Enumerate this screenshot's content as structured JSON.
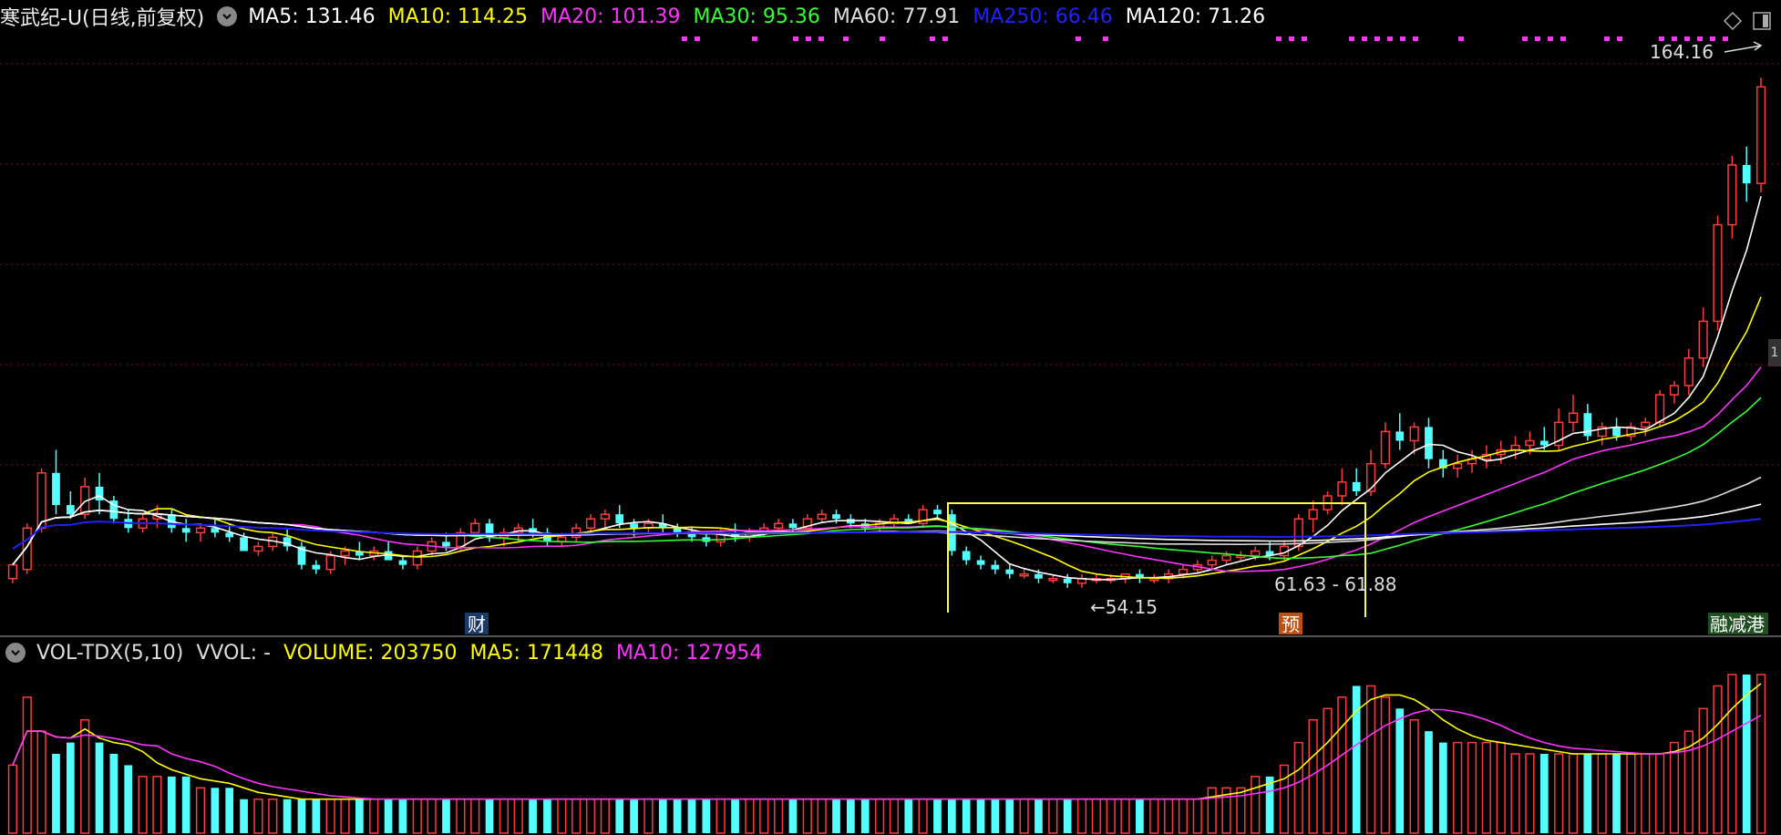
{
  "main": {
    "stock_name": "寒武纪-U(日线,前复权)",
    "ma": [
      {
        "label": "MA5:",
        "value": "131.46",
        "color": "#ffffff"
      },
      {
        "label": "MA10:",
        "value": "114.25",
        "color": "#ffff00"
      },
      {
        "label": "MA20:",
        "value": "101.39",
        "color": "#ff33ff"
      },
      {
        "label": "MA30:",
        "value": "95.36",
        "color": "#33ff33"
      },
      {
        "label": "MA60:",
        "value": "77.91",
        "color": "#dddddd"
      },
      {
        "label": "MA250:",
        "value": "66.46",
        "color": "#2020ff"
      },
      {
        "label": "MA120:",
        "value": "71.26",
        "color": "#ffffff"
      }
    ],
    "high_label": "164.16",
    "low_label": "54.15",
    "range_label": "61.63 - 61.88",
    "marker_cai": "财",
    "marker_yu": "预",
    "marker_right": "融减港",
    "side_tab": "1"
  },
  "volume": {
    "indicator": "VOL-TDX(5,10)",
    "vvol": "VVOL: -",
    "volume": "VOLUME: 203750",
    "ma5": "MA5: 171448",
    "ma10": "MA10: 127954"
  },
  "colors": {
    "up": "#ff3b3b",
    "down": "#54ffff",
    "ma5": "#ffffff",
    "ma10": "#ffff00",
    "ma20": "#ff33ff",
    "ma30": "#33ff33",
    "ma60": "#dddddd",
    "ma120": "#ffffff",
    "ma250": "#2020ff",
    "grid": "#7a1010",
    "box": "#ffff44"
  },
  "chart_data": {
    "type": "candlestick",
    "candles": [
      [
        56,
        59,
        55,
        59
      ],
      [
        58,
        68,
        57,
        67
      ],
      [
        67,
        80,
        66,
        79
      ],
      [
        79,
        84,
        70,
        72
      ],
      [
        72,
        75,
        69,
        70
      ],
      [
        70,
        78,
        69,
        76
      ],
      [
        76,
        79,
        70,
        73
      ],
      [
        73,
        74,
        68,
        69
      ],
      [
        69,
        71,
        66,
        67
      ],
      [
        67,
        70,
        66,
        69
      ],
      [
        69,
        72,
        67,
        70
      ],
      [
        70,
        71,
        66,
        67
      ],
      [
        67,
        69,
        64,
        66
      ],
      [
        66,
        68,
        64,
        67
      ],
      [
        67,
        69,
        65,
        66
      ],
      [
        66,
        68,
        64,
        65
      ],
      [
        65,
        66,
        62,
        62
      ],
      [
        62,
        64,
        61,
        63
      ],
      [
        63,
        66,
        62,
        65
      ],
      [
        65,
        67,
        62,
        63
      ],
      [
        63,
        64,
        58,
        59
      ],
      [
        59,
        60,
        57,
        58
      ],
      [
        58,
        62,
        57,
        61
      ],
      [
        61,
        63,
        59,
        62
      ],
      [
        62,
        64,
        60,
        61
      ],
      [
        61,
        63,
        60,
        62
      ],
      [
        62,
        64,
        60,
        60
      ],
      [
        60,
        61,
        58,
        59
      ],
      [
        59,
        63,
        58,
        62
      ],
      [
        62,
        65,
        61,
        64
      ],
      [
        64,
        66,
        62,
        63
      ],
      [
        63,
        67,
        62,
        66
      ],
      [
        66,
        69,
        65,
        68
      ],
      [
        68,
        69,
        64,
        65
      ],
      [
        65,
        67,
        63,
        66
      ],
      [
        66,
        68,
        64,
        67
      ],
      [
        67,
        69,
        65,
        66
      ],
      [
        66,
        67,
        63,
        64
      ],
      [
        64,
        66,
        63,
        65
      ],
      [
        65,
        68,
        64,
        67
      ],
      [
        67,
        70,
        66,
        69
      ],
      [
        69,
        71,
        67,
        70
      ],
      [
        70,
        72,
        67,
        68
      ],
      [
        68,
        69,
        65,
        67
      ],
      [
        67,
        69,
        66,
        68
      ],
      [
        68,
        70,
        66,
        67
      ],
      [
        67,
        68,
        65,
        66
      ],
      [
        66,
        67,
        64,
        65
      ],
      [
        65,
        66,
        63,
        64
      ],
      [
        64,
        67,
        63,
        66
      ],
      [
        66,
        68,
        64,
        65
      ],
      [
        65,
        67,
        64,
        66
      ],
      [
        66,
        68,
        65,
        67
      ],
      [
        67,
        69,
        66,
        68
      ],
      [
        68,
        69,
        66,
        67
      ],
      [
        67,
        70,
        66,
        69
      ],
      [
        69,
        71,
        68,
        70
      ],
      [
        70,
        71,
        68,
        69
      ],
      [
        69,
        70,
        67,
        68
      ],
      [
        68,
        69,
        66,
        67
      ],
      [
        67,
        69,
        66,
        68
      ],
      [
        68,
        70,
        67,
        69
      ],
      [
        69,
        70,
        68,
        68
      ],
      [
        68,
        72,
        67,
        71
      ],
      [
        71,
        72,
        69,
        70
      ],
      [
        70,
        71,
        61,
        62
      ],
      [
        62,
        63,
        59,
        60
      ],
      [
        60,
        61,
        58,
        59
      ],
      [
        59,
        60,
        57,
        58
      ],
      [
        58,
        59,
        56,
        57
      ],
      [
        57,
        58,
        56,
        57
      ],
      [
        57,
        58,
        55,
        56
      ],
      [
        56,
        57,
        55,
        56
      ],
      [
        56,
        57,
        54,
        55
      ],
      [
        55,
        57,
        54,
        56
      ],
      [
        56,
        57,
        55,
        56
      ],
      [
        56,
        57,
        55,
        56
      ],
      [
        56,
        57,
        55,
        57
      ],
      [
        57,
        58,
        55,
        56
      ],
      [
        56,
        57,
        55,
        56
      ],
      [
        56,
        58,
        55,
        57
      ],
      [
        57,
        59,
        56,
        58
      ],
      [
        58,
        60,
        57,
        59
      ],
      [
        59,
        61,
        58,
        60
      ],
      [
        60,
        62,
        59,
        61
      ],
      [
        61,
        62,
        60,
        61
      ],
      [
        61,
        63,
        60,
        62
      ],
      [
        62,
        64,
        60,
        61
      ],
      [
        61,
        64,
        60,
        63
      ],
      [
        63,
        70,
        62,
        69
      ],
      [
        69,
        73,
        66,
        71
      ],
      [
        71,
        75,
        70,
        74
      ],
      [
        74,
        80,
        72,
        77
      ],
      [
        77,
        80,
        74,
        75
      ],
      [
        75,
        84,
        74,
        81
      ],
      [
        81,
        90,
        80,
        88
      ],
      [
        88,
        92,
        84,
        86
      ],
      [
        86,
        90,
        83,
        89
      ],
      [
        89,
        91,
        80,
        82
      ],
      [
        82,
        84,
        78,
        80
      ],
      [
        80,
        83,
        78,
        81
      ],
      [
        81,
        84,
        79,
        82
      ],
      [
        82,
        85,
        80,
        83
      ],
      [
        83,
        86,
        81,
        84
      ],
      [
        84,
        87,
        82,
        85
      ],
      [
        85,
        88,
        83,
        86
      ],
      [
        86,
        89,
        84,
        85
      ],
      [
        85,
        93,
        84,
        90
      ],
      [
        90,
        96,
        88,
        92
      ],
      [
        92,
        94,
        86,
        87
      ],
      [
        87,
        90,
        85,
        89
      ],
      [
        89,
        91,
        86,
        87
      ],
      [
        87,
        90,
        86,
        89
      ],
      [
        89,
        91,
        87,
        90
      ],
      [
        90,
        97,
        89,
        96
      ],
      [
        96,
        99,
        94,
        98
      ],
      [
        98,
        106,
        96,
        104
      ],
      [
        104,
        115,
        102,
        112
      ],
      [
        112,
        135,
        110,
        133
      ],
      [
        133,
        148,
        130,
        146
      ],
      [
        146,
        150,
        138,
        142
      ],
      [
        142,
        165,
        140,
        163
      ]
    ],
    "volume": [
      6,
      12,
      9,
      7,
      8,
      10,
      8,
      7,
      6,
      5,
      5,
      5,
      5,
      4,
      4,
      4,
      3,
      3,
      3,
      3,
      3,
      3,
      3,
      3,
      3,
      3,
      3,
      3,
      3,
      3,
      3,
      3,
      3,
      3,
      3,
      3,
      3,
      3,
      3,
      3,
      3,
      3,
      3,
      3,
      3,
      3,
      3,
      3,
      3,
      3,
      3,
      3,
      3,
      3,
      3,
      3,
      3,
      3,
      3,
      3,
      3,
      3,
      3,
      3,
      3,
      3,
      3,
      3,
      3,
      3,
      3,
      3,
      3,
      3,
      3,
      3,
      3,
      3,
      3,
      3,
      3,
      3,
      3,
      4,
      4,
      4,
      5,
      5,
      6,
      8,
      10,
      11,
      12,
      13,
      13,
      12,
      11,
      10,
      9,
      8,
      8,
      8,
      8,
      8,
      7,
      7,
      7,
      7,
      7,
      7,
      7,
      7,
      7,
      7,
      7,
      8,
      9,
      11,
      13,
      14,
      14,
      14
    ],
    "ylim": [
      50,
      170
    ],
    "vol_ylim": [
      0,
      14
    ]
  }
}
